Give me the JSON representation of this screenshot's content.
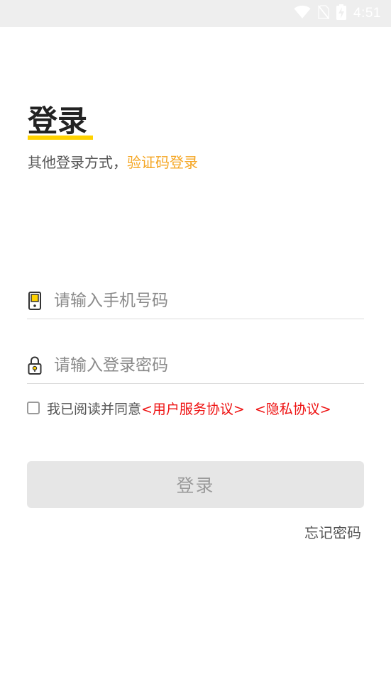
{
  "status_bar": {
    "time": "4:51",
    "icons": [
      "wifi-icon",
      "no-sim-icon",
      "battery-charging-icon"
    ]
  },
  "login": {
    "title": "登录",
    "alt_prefix": "其他登录方式，",
    "alt_link": "验证码登录",
    "phone_placeholder": "请输入手机号码",
    "password_placeholder": "请输入登录密码",
    "agree_text": "我已阅读并同意",
    "terms_link": "<用户服务协议>",
    "privacy_link": "<隐私协议>",
    "submit_label": "登录",
    "forgot_label": "忘记密码"
  },
  "colors": {
    "accent_yellow": "#ffd200",
    "link_orange": "#f5a623",
    "link_red": "#ee1111",
    "button_disabled": "#e6e6e6"
  }
}
